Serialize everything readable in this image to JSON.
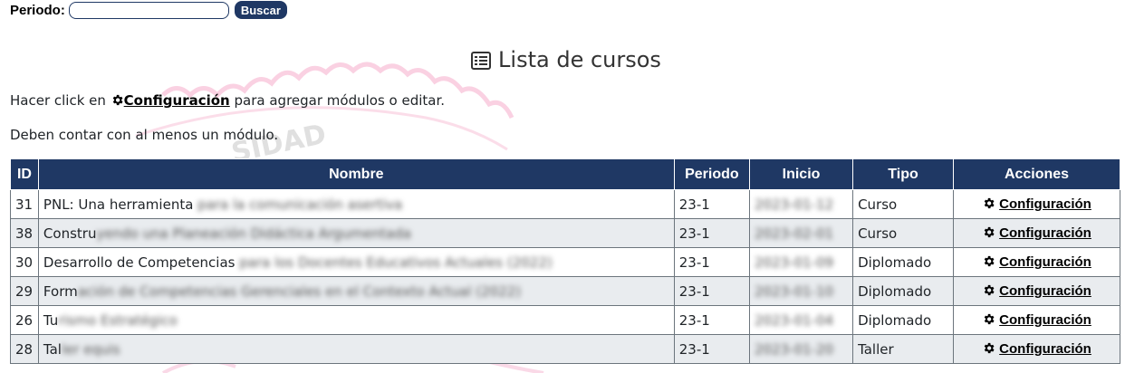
{
  "search": {
    "label": "Periodo:",
    "value": "",
    "placeholder": "",
    "button": "Buscar"
  },
  "title": "Lista de cursos",
  "instructions": {
    "prefix": "Hacer click en ",
    "link": "Configuración",
    "suffix": " para agregar módulos o editar.",
    "line2": "Deben contar con al menos un módulo."
  },
  "table": {
    "headers": [
      "ID",
      "Nombre",
      "Periodo",
      "Inicio",
      "Tipo",
      "Acciones"
    ],
    "rows": [
      {
        "id": "31",
        "name_visible": "PNL: Una herramienta",
        "name_hidden": " para la comunicación asertiva",
        "period": "23-1",
        "start": "2023-01-12",
        "type": "Curso",
        "action": "Configuración"
      },
      {
        "id": "38",
        "name_visible": "Constru",
        "name_hidden": "yendo una Planeación Didáctica Argumentada",
        "period": "23-1",
        "start": "2023-02-01",
        "type": "Curso",
        "action": "Configuración"
      },
      {
        "id": "30",
        "name_visible": "Desarrollo de Competencias ",
        "name_hidden": "para los Docentes Educativos Actuales (2022)",
        "period": "23-1",
        "start": "2023-01-09",
        "type": "Diplomado",
        "action": "Configuración"
      },
      {
        "id": "29",
        "name_visible": "Form",
        "name_hidden": "ación de Competencias Gerenciales en el Contexto Actual (2022)",
        "period": "23-1",
        "start": "2023-01-10",
        "type": "Diplomado",
        "action": "Configuración"
      },
      {
        "id": "26",
        "name_visible": "Tu",
        "name_hidden": "rismo Estratégico",
        "period": "23-1",
        "start": "2023-01-04",
        "type": "Diplomado",
        "action": "Configuración"
      },
      {
        "id": "28",
        "name_visible": "Tal",
        "name_hidden": "ler equis",
        "period": "23-1",
        "start": "2023-01-20",
        "type": "Taller",
        "action": "Configuración"
      }
    ]
  },
  "colors": {
    "header_bg": "#1f3864",
    "stripe": "#e9ecef",
    "watermark": "#f4a6c6"
  },
  "icons": {
    "title": "list-alt-icon",
    "gear": "gear-icon"
  }
}
